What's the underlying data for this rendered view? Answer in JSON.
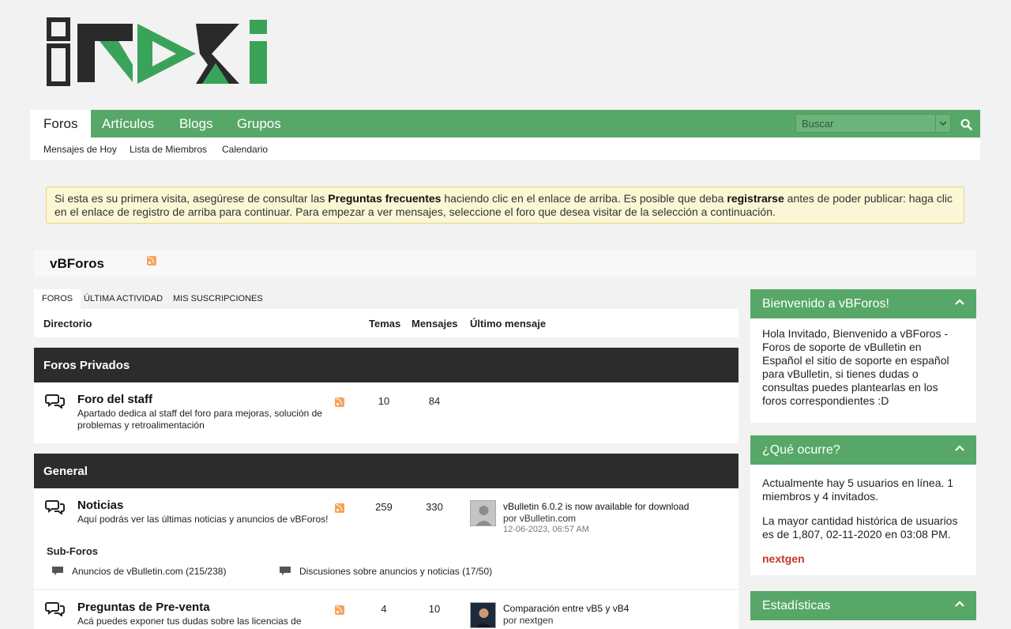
{
  "brand": {
    "logo_text": "iNDXi",
    "accent": "#57a868",
    "dark": "#2c2c2c"
  },
  "nav": {
    "tabs": [
      {
        "label": "Foros"
      },
      {
        "label": "Artículos"
      },
      {
        "label": "Blogs"
      },
      {
        "label": "Grupos"
      }
    ],
    "search_placeholder": "Buscar",
    "subnav": [
      {
        "label": "Mensajes de Hoy"
      },
      {
        "label": "Lista de Miembros"
      },
      {
        "label": "Calendario"
      }
    ]
  },
  "notice": {
    "part1": "Si esta es su primera visita, asegúrese de consultar las ",
    "link1": "Preguntas frecuentes",
    "part2": " haciendo clic en el enlace de arriba. Es posible que deba ",
    "link2": "registrarse",
    "part3": " antes de poder publicar: haga clic en el enlace de registro de arriba para continuar. Para empezar a ver mensajes, seleccione el foro que desea visitar de la selección a continuación."
  },
  "page_title": "vBForos",
  "list_tabs": [
    {
      "label": "FOROS"
    },
    {
      "label": "ÚLTIMA ACTIVIDAD"
    },
    {
      "label": "MIS SUSCRIPCIONES"
    }
  ],
  "columns": {
    "directory": "Directorio",
    "topics": "Temas",
    "posts": "Mensajes",
    "last": "Último mensaje"
  },
  "categories": [
    {
      "title": "Foros Privados"
    },
    {
      "title": "General"
    }
  ],
  "forums": [
    {
      "name": "Foro del staff",
      "desc": "Apartado dedica al staff del foro para mejoras, solución de problemas y retroalimentación",
      "topics": "10",
      "posts": "84"
    },
    {
      "name": "Noticias",
      "desc": "Aquí podrás ver las últimas noticias y anuncios de vBForos!",
      "topics": "259",
      "posts": "330",
      "last_title": "vBulletin 6.0.2 is now available for download",
      "last_by_prefix": "por ",
      "last_by": "vBulletin.com",
      "last_date": "12-06-2023, 06:57 AM",
      "subforos_label": "Sub-Foros",
      "subforums": [
        {
          "label": "Anuncios de vBulletin.com (215/238)"
        },
        {
          "label": "Discusiones sobre anuncios y noticias (17/50)"
        }
      ]
    },
    {
      "name": "Preguntas de Pre-venta",
      "desc": "Acá puedes exponer tus dudas sobre las licencias de",
      "topics": "4",
      "posts": "10",
      "last_title": "Comparación entre vB5 y vB4",
      "last_by_prefix": "por ",
      "last_by": "nextgen"
    }
  ],
  "sidebar": {
    "welcome": {
      "title": "Bienvenido a vBForos!",
      "body": "Hola Invitado, Bienvenido a vBForos - Foros de soporte de vBulletin en Español el sitio de soporte en español para vBulletin, si tienes dudas o consultas puedes plantearlas en los foros correspondientes :D"
    },
    "online": {
      "title": "¿Qué ocurre?",
      "line1_a": "Actualmente hay 5 ",
      "line1_link": "usuarios en línea",
      "line1_b": ". 1 miembros y 4 invitados.",
      "line2": "La mayor cantidad histórica de usuarios es de 1,807, 02-11-2020 en 03:08 PM.",
      "member": "nextgen"
    },
    "stats": {
      "title": "Estadísticas"
    }
  }
}
